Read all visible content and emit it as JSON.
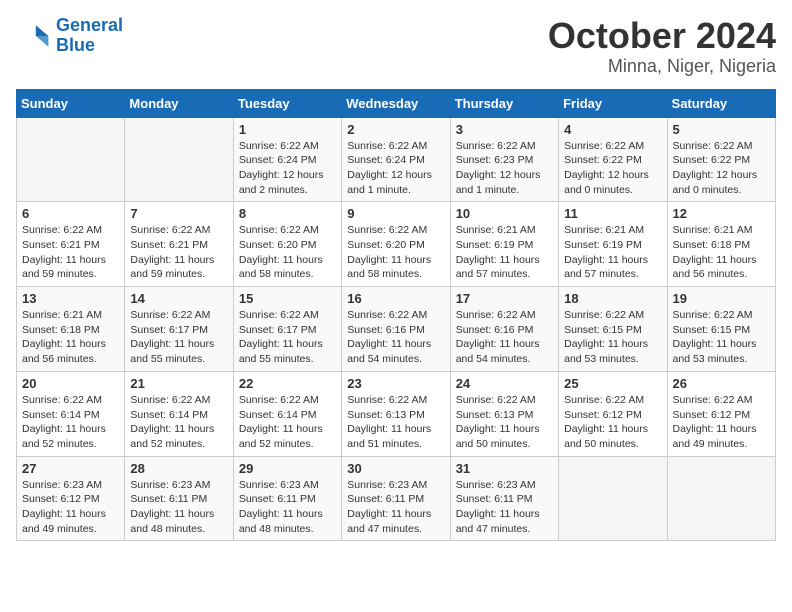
{
  "header": {
    "logo_line1": "General",
    "logo_line2": "Blue",
    "title": "October 2024",
    "subtitle": "Minna, Niger, Nigeria"
  },
  "calendar": {
    "weekdays": [
      "Sunday",
      "Monday",
      "Tuesday",
      "Wednesday",
      "Thursday",
      "Friday",
      "Saturday"
    ],
    "weeks": [
      [
        {
          "day": "",
          "info": ""
        },
        {
          "day": "",
          "info": ""
        },
        {
          "day": "1",
          "info": "Sunrise: 6:22 AM\nSunset: 6:24 PM\nDaylight: 12 hours and 2 minutes."
        },
        {
          "day": "2",
          "info": "Sunrise: 6:22 AM\nSunset: 6:24 PM\nDaylight: 12 hours and 1 minute."
        },
        {
          "day": "3",
          "info": "Sunrise: 6:22 AM\nSunset: 6:23 PM\nDaylight: 12 hours and 1 minute."
        },
        {
          "day": "4",
          "info": "Sunrise: 6:22 AM\nSunset: 6:22 PM\nDaylight: 12 hours and 0 minutes."
        },
        {
          "day": "5",
          "info": "Sunrise: 6:22 AM\nSunset: 6:22 PM\nDaylight: 12 hours and 0 minutes."
        }
      ],
      [
        {
          "day": "6",
          "info": "Sunrise: 6:22 AM\nSunset: 6:21 PM\nDaylight: 11 hours and 59 minutes."
        },
        {
          "day": "7",
          "info": "Sunrise: 6:22 AM\nSunset: 6:21 PM\nDaylight: 11 hours and 59 minutes."
        },
        {
          "day": "8",
          "info": "Sunrise: 6:22 AM\nSunset: 6:20 PM\nDaylight: 11 hours and 58 minutes."
        },
        {
          "day": "9",
          "info": "Sunrise: 6:22 AM\nSunset: 6:20 PM\nDaylight: 11 hours and 58 minutes."
        },
        {
          "day": "10",
          "info": "Sunrise: 6:21 AM\nSunset: 6:19 PM\nDaylight: 11 hours and 57 minutes."
        },
        {
          "day": "11",
          "info": "Sunrise: 6:21 AM\nSunset: 6:19 PM\nDaylight: 11 hours and 57 minutes."
        },
        {
          "day": "12",
          "info": "Sunrise: 6:21 AM\nSunset: 6:18 PM\nDaylight: 11 hours and 56 minutes."
        }
      ],
      [
        {
          "day": "13",
          "info": "Sunrise: 6:21 AM\nSunset: 6:18 PM\nDaylight: 11 hours and 56 minutes."
        },
        {
          "day": "14",
          "info": "Sunrise: 6:22 AM\nSunset: 6:17 PM\nDaylight: 11 hours and 55 minutes."
        },
        {
          "day": "15",
          "info": "Sunrise: 6:22 AM\nSunset: 6:17 PM\nDaylight: 11 hours and 55 minutes."
        },
        {
          "day": "16",
          "info": "Sunrise: 6:22 AM\nSunset: 6:16 PM\nDaylight: 11 hours and 54 minutes."
        },
        {
          "day": "17",
          "info": "Sunrise: 6:22 AM\nSunset: 6:16 PM\nDaylight: 11 hours and 54 minutes."
        },
        {
          "day": "18",
          "info": "Sunrise: 6:22 AM\nSunset: 6:15 PM\nDaylight: 11 hours and 53 minutes."
        },
        {
          "day": "19",
          "info": "Sunrise: 6:22 AM\nSunset: 6:15 PM\nDaylight: 11 hours and 53 minutes."
        }
      ],
      [
        {
          "day": "20",
          "info": "Sunrise: 6:22 AM\nSunset: 6:14 PM\nDaylight: 11 hours and 52 minutes."
        },
        {
          "day": "21",
          "info": "Sunrise: 6:22 AM\nSunset: 6:14 PM\nDaylight: 11 hours and 52 minutes."
        },
        {
          "day": "22",
          "info": "Sunrise: 6:22 AM\nSunset: 6:14 PM\nDaylight: 11 hours and 52 minutes."
        },
        {
          "day": "23",
          "info": "Sunrise: 6:22 AM\nSunset: 6:13 PM\nDaylight: 11 hours and 51 minutes."
        },
        {
          "day": "24",
          "info": "Sunrise: 6:22 AM\nSunset: 6:13 PM\nDaylight: 11 hours and 50 minutes."
        },
        {
          "day": "25",
          "info": "Sunrise: 6:22 AM\nSunset: 6:12 PM\nDaylight: 11 hours and 50 minutes."
        },
        {
          "day": "26",
          "info": "Sunrise: 6:22 AM\nSunset: 6:12 PM\nDaylight: 11 hours and 49 minutes."
        }
      ],
      [
        {
          "day": "27",
          "info": "Sunrise: 6:23 AM\nSunset: 6:12 PM\nDaylight: 11 hours and 49 minutes."
        },
        {
          "day": "28",
          "info": "Sunrise: 6:23 AM\nSunset: 6:11 PM\nDaylight: 11 hours and 48 minutes."
        },
        {
          "day": "29",
          "info": "Sunrise: 6:23 AM\nSunset: 6:11 PM\nDaylight: 11 hours and 48 minutes."
        },
        {
          "day": "30",
          "info": "Sunrise: 6:23 AM\nSunset: 6:11 PM\nDaylight: 11 hours and 47 minutes."
        },
        {
          "day": "31",
          "info": "Sunrise: 6:23 AM\nSunset: 6:11 PM\nDaylight: 11 hours and 47 minutes."
        },
        {
          "day": "",
          "info": ""
        },
        {
          "day": "",
          "info": ""
        }
      ]
    ]
  }
}
